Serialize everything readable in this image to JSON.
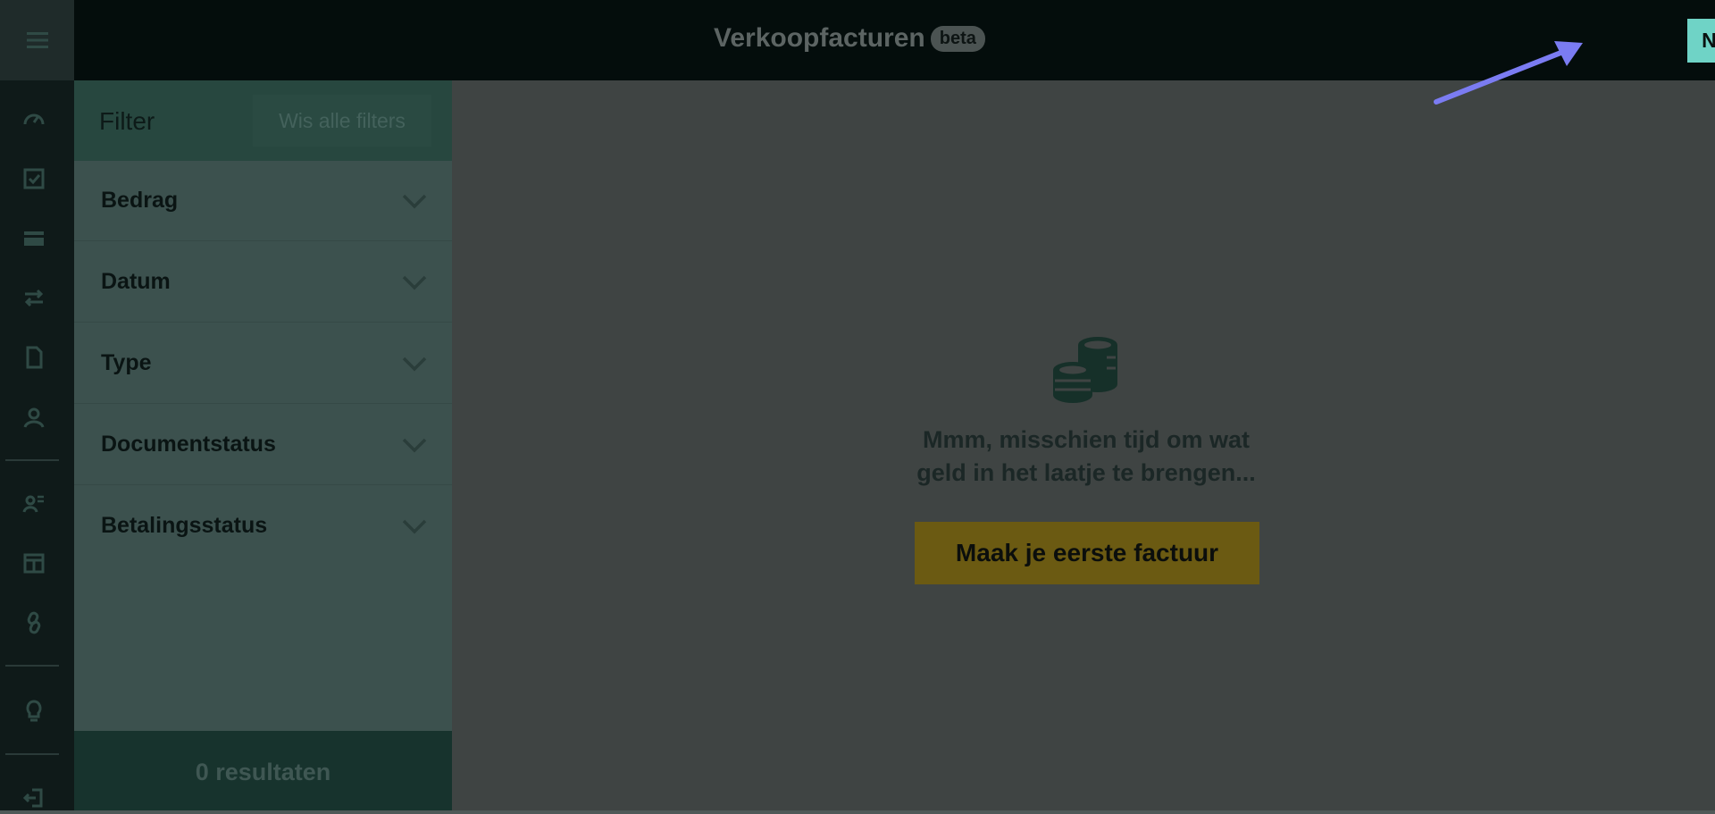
{
  "header": {
    "title": "Verkoopfacturen",
    "badge": "beta",
    "new_button_label": "Nieuw"
  },
  "rail": {
    "icons": [
      "menu-icon",
      "dashboard-icon",
      "checkbox-icon",
      "card-icon",
      "transfer-icon",
      "document-icon",
      "contacts-icon",
      "customer-list-icon",
      "store-icon",
      "link-icon",
      "lightbulb-icon",
      "logout-icon"
    ]
  },
  "filter": {
    "title": "Filter",
    "clear_all": "Wis alle filters",
    "sections": [
      {
        "label": "Bedrag"
      },
      {
        "label": "Datum"
      },
      {
        "label": "Type"
      },
      {
        "label": "Documentstatus"
      },
      {
        "label": "Betalingsstatus"
      }
    ],
    "results": "0 resultaten"
  },
  "empty_state": {
    "message_line1": "Mmm, misschien tijd om wat",
    "message_line2": "geld in het laatje te brengen...",
    "cta_label": "Maak je eerste factuur"
  },
  "colors": {
    "accent": "#6fd3c6",
    "cta": "#6b5a12",
    "annotation_arrow": "#7b7cf2"
  }
}
